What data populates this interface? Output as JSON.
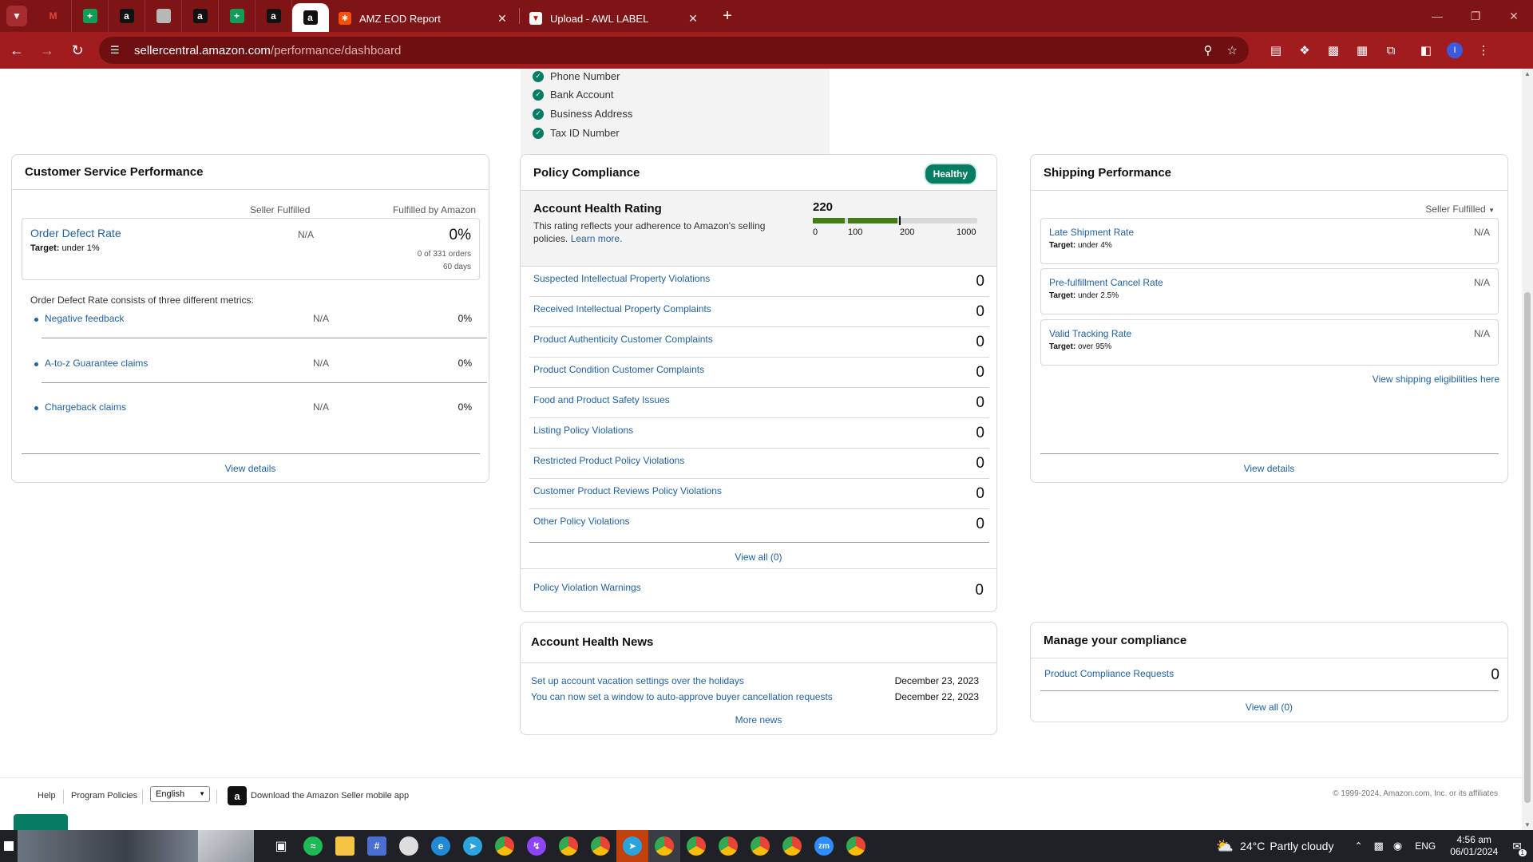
{
  "browser": {
    "tabs": [
      {
        "title": "AMZ EOD Report",
        "icon": "zapier-icon"
      },
      {
        "title": "Upload - AWL LABEL",
        "icon": "label-icon"
      }
    ],
    "url_host": "sellercentral.amazon.com",
    "url_path": "/performance/dashboard",
    "profile_initial": "I"
  },
  "verification": {
    "items": [
      "Phone Number",
      "Bank Account",
      "Business Address",
      "Tax ID Number"
    ]
  },
  "customer_service": {
    "title": "Customer Service Performance",
    "col_seller": "Seller Fulfilled",
    "col_fba": "Fulfilled by Amazon",
    "odr": {
      "label": "Order Defect Rate",
      "target_prefix": "Target:",
      "target": "under 1%",
      "seller_value": "N/A",
      "fba_value": "0%",
      "orders": "0 of 331 orders",
      "days": "60 days"
    },
    "consists_text": "Order Defect Rate consists of three different metrics:",
    "metrics": [
      {
        "label": "Negative feedback",
        "seller": "N/A",
        "fba": "0%"
      },
      {
        "label": "A-to-z Guarantee claims",
        "seller": "N/A",
        "fba": "0%"
      },
      {
        "label": "Chargeback claims",
        "seller": "N/A",
        "fba": "0%"
      }
    ],
    "view_details": "View details"
  },
  "policy": {
    "title": "Policy Compliance",
    "badge": "Healthy",
    "ahr_title": "Account Health Rating",
    "ahr_desc": "This rating reflects your adherence to Amazon's selling policies.",
    "learn_more": "Learn more.",
    "score": "220",
    "score_value": 220,
    "scale": [
      "0",
      "100",
      "200",
      "1000"
    ],
    "violations": [
      {
        "label": "Suspected Intellectual Property Violations",
        "value": "0"
      },
      {
        "label": "Received Intellectual Property Complaints",
        "value": "0"
      },
      {
        "label": "Product Authenticity Customer Complaints",
        "value": "0"
      },
      {
        "label": "Product Condition Customer Complaints",
        "value": "0"
      },
      {
        "label": "Food and Product Safety Issues",
        "value": "0"
      },
      {
        "label": "Listing Policy Violations",
        "value": "0"
      },
      {
        "label": "Restricted Product Policy Violations",
        "value": "0"
      },
      {
        "label": "Customer Product Reviews Policy Violations",
        "value": "0"
      },
      {
        "label": "Other Policy Violations",
        "value": "0"
      }
    ],
    "view_all": "View all (0)",
    "warnings_label": "Policy Violation Warnings",
    "warnings_value": "0"
  },
  "shipping": {
    "title": "Shipping Performance",
    "dropdown": "Seller Fulfilled",
    "metrics": [
      {
        "label": "Late Shipment Rate",
        "target_prefix": "Target:",
        "target": "under 4%",
        "value": "N/A"
      },
      {
        "label": "Pre-fulfillment Cancel Rate",
        "target_prefix": "Target:",
        "target": "under 2.5%",
        "value": "N/A"
      },
      {
        "label": "Valid Tracking Rate",
        "target_prefix": "Target:",
        "target": "over 95%",
        "value": "N/A"
      }
    ],
    "eligibilities_link": "View shipping eligibilities here",
    "view_details": "View details"
  },
  "news": {
    "title": "Account Health News",
    "items": [
      {
        "text": "Set up account vacation settings over the holidays",
        "date": "December 23, 2023"
      },
      {
        "text": "You can now set a window to auto-approve buyer cancellation requests",
        "date": "December 22, 2023"
      }
    ],
    "more": "More news"
  },
  "compliance": {
    "title": "Manage your compliance",
    "requests_label": "Product Compliance Requests",
    "requests_value": "0",
    "view_all": "View all (0)"
  },
  "footer": {
    "help": "Help",
    "program_policies": "Program Policies",
    "language": "English",
    "app_text": "Download the Amazon Seller mobile app",
    "copyright": "© 1999-2024, Amazon.com, Inc. or its affiliates"
  },
  "taskbar": {
    "temp": "24°C",
    "weather": "Partly cloudy",
    "lang": "ENG",
    "time": "4:56 am",
    "date": "06/01/2024",
    "notif_count": "1"
  },
  "colors": {
    "tabbar": "#7f1416",
    "toolbar": "#a01c1f",
    "link": "#2162a1",
    "healthy": "#067d62",
    "rating_bar": "#437d1a"
  }
}
